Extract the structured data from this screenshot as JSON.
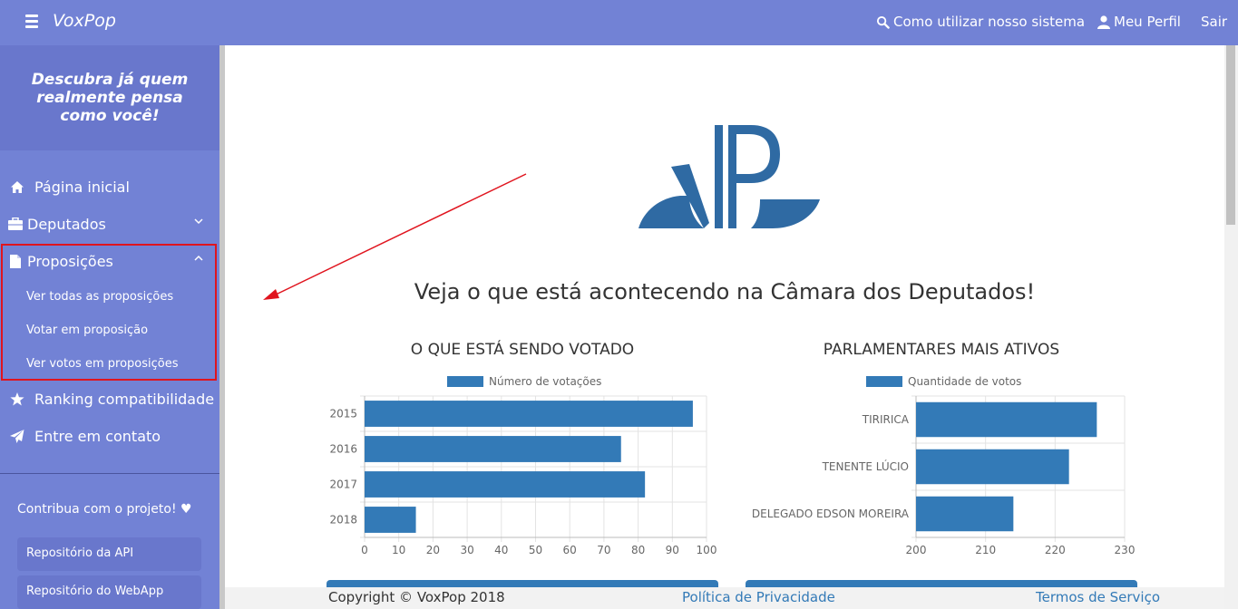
{
  "topbar": {
    "brand": "VoxPop",
    "help_link": "Como utilizar nosso sistema",
    "profile_link": "Meu Perfil",
    "logout_link": "Sair"
  },
  "sidebar": {
    "tagline": "Descubra já quem realmente pensa como você!",
    "items": [
      {
        "label": "Página inicial",
        "icon": "home-icon"
      },
      {
        "label": "Deputados",
        "icon": "briefcase-icon"
      },
      {
        "label": "Proposições",
        "icon": "file-icon"
      },
      {
        "label": "Ranking compatibilidade",
        "icon": "star-icon"
      },
      {
        "label": "Entre em contato",
        "icon": "paper-plane-icon"
      }
    ],
    "subitems": [
      {
        "label": "Ver todas as proposições"
      },
      {
        "label": "Votar em proposição"
      },
      {
        "label": "Ver votos em proposições"
      }
    ],
    "contribute": "Contribua com o projeto! ♥",
    "buttons": [
      {
        "label": "Repositório da API"
      },
      {
        "label": "Repositório do WebApp"
      }
    ]
  },
  "main": {
    "headline": "Veja o que está acontecendo na Câmara dos Deputados!"
  },
  "chart_data": [
    {
      "type": "bar",
      "orientation": "horizontal",
      "title": "O QUE ESTÁ SENDO VOTADO",
      "categories": [
        "2015",
        "2016",
        "2017",
        "2018"
      ],
      "series": [
        {
          "name": "Número de votações",
          "values": [
            96,
            75,
            82,
            15
          ]
        }
      ],
      "xlim": [
        0,
        100
      ],
      "ticks": [
        0,
        10,
        20,
        30,
        40,
        50,
        60,
        70,
        80,
        90,
        100
      ],
      "legend": "top",
      "grid": true,
      "color": "#337ab7"
    },
    {
      "type": "bar",
      "orientation": "horizontal",
      "title": "PARLAMENTARES MAIS ATIVOS",
      "categories": [
        "TIRIRICA",
        "TENENTE LÚCIO",
        "DELEGADO EDSON MOREIRA"
      ],
      "series": [
        {
          "name": "Quantidade de votos",
          "values": [
            226,
            222,
            214
          ]
        }
      ],
      "xlim": [
        200,
        230
      ],
      "ticks": [
        200,
        210,
        220,
        230
      ],
      "legend": "top",
      "grid": true,
      "color": "#337ab7"
    }
  ],
  "footer": {
    "copyright": "Copyright © VoxPop 2018",
    "privacy": "Política de Privacidade",
    "terms": "Termos de Serviço"
  },
  "colors": {
    "navbar": "#7282d5",
    "bar": "#337ab7",
    "annotation": "#e0141e",
    "logo": "#2f6aa3"
  }
}
